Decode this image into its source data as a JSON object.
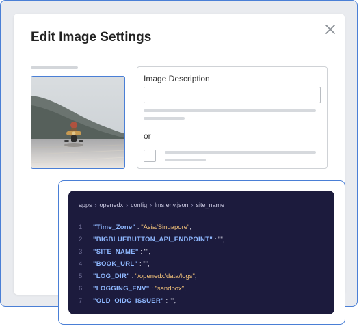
{
  "modal": {
    "title": "Edit Image Settings"
  },
  "settings": {
    "description_label": "Image Description",
    "description_value": "",
    "or_label": "or"
  },
  "code": {
    "breadcrumb": [
      "apps",
      "openedx",
      "config",
      "lms.env.json",
      "site_name"
    ],
    "lines": [
      {
        "num": "1",
        "key": "\"Time_Zone\"",
        "sep": " :  ",
        "value": "\"Asia/Singapore\"",
        "end": ","
      },
      {
        "num": "2",
        "key": "\"BIGBLUEBUTTON_API_ENDPOINT\"",
        "sep": " : ",
        "value": "\"\"",
        "end": ","
      },
      {
        "num": "3",
        "key": "\"SITE_NAME\"",
        "sep": " : ",
        "value": "\"\"",
        "end": ","
      },
      {
        "num": "4",
        "key": "\"BOOK_URL\"",
        "sep": " : ",
        "value": "\"\"",
        "end": ","
      },
      {
        "num": "5",
        "key": "\"LOG_DIR\"",
        "sep": " :  ",
        "value": "\"/openedx/data/logs\"",
        "end": ","
      },
      {
        "num": "6",
        "key": "\"LOGGING_ENV\"",
        "sep": " :  ",
        "value": "\"sandbox\"",
        "end": ","
      },
      {
        "num": "7",
        "key": "\"OLD_OIDC_ISSUER\"",
        "sep": " : ",
        "value": "\"\"",
        "end": ","
      }
    ]
  },
  "colors": {
    "accent_blue": "#4a7fd6",
    "code_background": "#1c1b3d",
    "code_key": "#8fb8ff",
    "code_value": "#f2c27a"
  },
  "icons": {
    "close": "close-icon",
    "crumb_separator": "chevron-right-icon"
  }
}
